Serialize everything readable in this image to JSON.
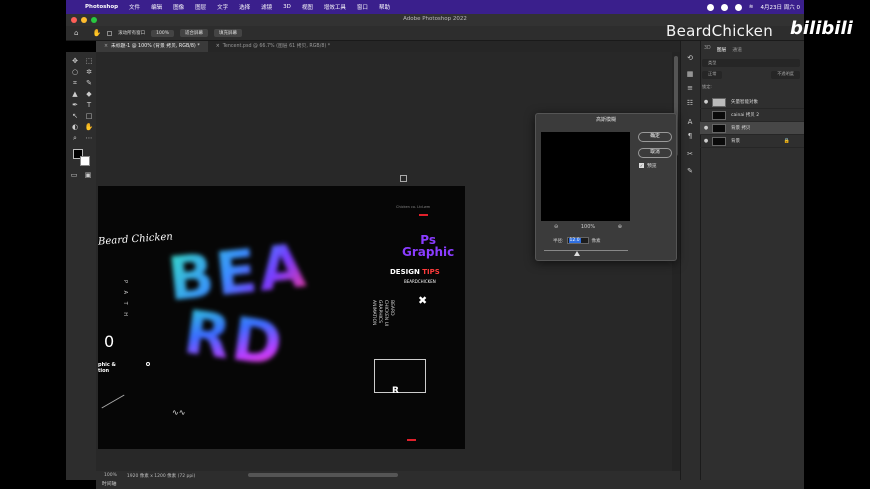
{
  "menubar": {
    "app": "Photoshop",
    "items": [
      "文件",
      "编辑",
      "图像",
      "图层",
      "文字",
      "选择",
      "滤镜",
      "3D",
      "视图",
      "增效工具",
      "窗口",
      "帮助"
    ],
    "datetime": "4月23日 周六 0"
  },
  "window": {
    "title": "Adobe Photoshop 2022"
  },
  "options_bar": {
    "scroll_all": "滚动所有窗口",
    "zoom": "100%",
    "fit_screen": "适合屏幕",
    "fill_screen": "填充屏幕"
  },
  "tabs": [
    {
      "label": "未标题-1 @ 100% (背景 拷贝, RGB/8) *",
      "active": true
    },
    {
      "label": "Tencent.psd @ 66.7% (图层 61 拷贝, RGB/8) *",
      "active": false
    }
  ],
  "artwork": {
    "script_name": "Beard Chicken",
    "path_text": "P A T H",
    "zero": "0",
    "graphic_lines": [
      "phic &",
      "tion"
    ],
    "blur_word_1": "BEA",
    "blur_word_2": "RD",
    "ps_line1": "Ps",
    "ps_line2": "Graphic",
    "design": "DESIGN",
    "tips": "TIPS",
    "beardchicken": "BEARDCHICKEN",
    "x_mark": "✖",
    "vertical_block": [
      "BEARD",
      "CHICKEN UI",
      "GRAPHICS",
      "ANIMATION"
    ],
    "r_letter": "R",
    "wave": "∿∿",
    "small_top": "Chicken co. Ltd.wm"
  },
  "statusbar": {
    "zoom": "100%",
    "doc_info": "1920 像素 x 1200 像素 (72 ppi)"
  },
  "timeline": {
    "label": "时间轴"
  },
  "layers_panel": {
    "tabs": [
      "3D",
      "图层",
      "通道"
    ],
    "filter": "类型",
    "blend_mode": "正常",
    "opacity_label": "不透明度",
    "lock_label": "锁定:",
    "layers": [
      {
        "name": "矢量智能对象",
        "thumb": "light",
        "selected": false,
        "locked": false
      },
      {
        "name": "cainai 拷贝 2",
        "thumb": "dark",
        "selected": false,
        "locked": false
      },
      {
        "name": "背景 拷贝",
        "thumb": "dark",
        "selected": true,
        "locked": false
      },
      {
        "name": "背景",
        "thumb": "dark",
        "selected": false,
        "locked": true
      }
    ]
  },
  "gaussian_dialog": {
    "title": "高斯模糊",
    "ok": "确定",
    "cancel": "取消",
    "preview": "预览",
    "zoom": "100%",
    "radius_label": "半径:",
    "radius_value": "12.0",
    "unit": "像素"
  },
  "watermark": {
    "text": "BeardChicken",
    "logo": "bilibili"
  }
}
